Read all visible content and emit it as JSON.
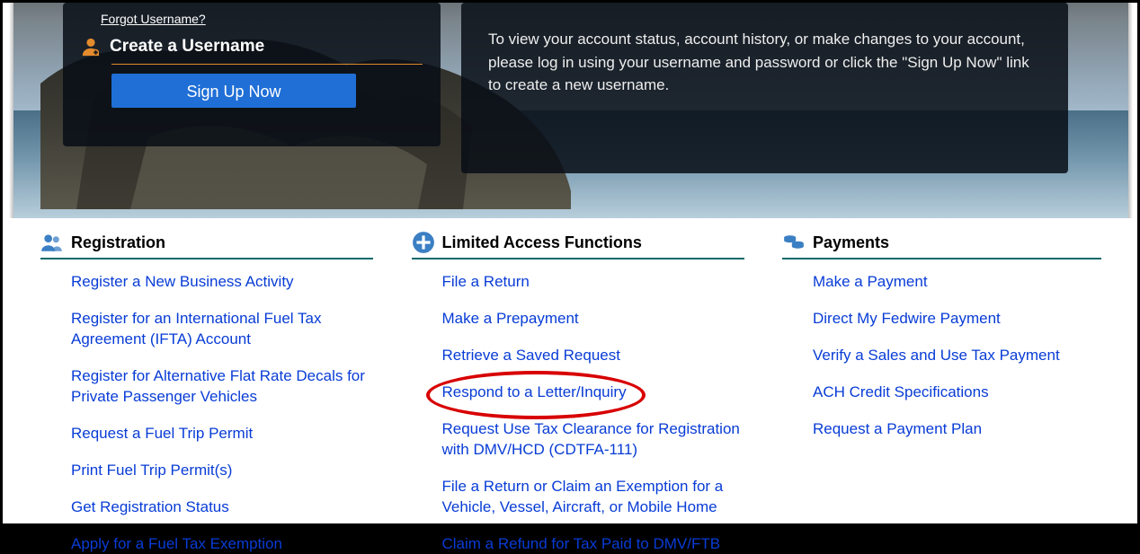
{
  "login_card": {
    "forgot_username": "Forgot Username?",
    "create_username": "Create a Username",
    "signup_button": "Sign Up Now"
  },
  "info_card": {
    "text": "To view your account status, account history, or make changes to your account, please log in using your username and password or click the \"Sign Up Now\" link to create a new username."
  },
  "sections": {
    "registration": {
      "title": "Registration",
      "links": [
        "Register a New Business Activity",
        "Register for an International Fuel Tax Agreement (IFTA) Account",
        "Register for Alternative Flat Rate Decals for Private Passenger Vehicles",
        "Request a Fuel Trip Permit",
        "Print Fuel Trip Permit(s)",
        "Get Registration Status",
        "Apply for a Fuel Tax Exemption"
      ]
    },
    "limited": {
      "title": "Limited Access Functions",
      "links": [
        "File a Return",
        "Make a Prepayment",
        "Retrieve a Saved Request",
        "Respond to a Letter/Inquiry",
        "Request Use Tax Clearance for Registration with DMV/HCD (CDTFA-111)",
        "File a Return or Claim an Exemption for a Vehicle, Vessel, Aircraft, or Mobile Home",
        "Claim a Refund for Tax Paid to DMV/FTB"
      ],
      "highlight_index": 3
    },
    "payments": {
      "title": "Payments",
      "links": [
        "Make a Payment",
        "Direct My Fedwire Payment",
        "Verify a Sales and Use Tax Payment",
        "ACH Credit Specifications",
        "Request a Payment Plan"
      ]
    }
  },
  "colors": {
    "accent_orange": "#e38b2e",
    "link_blue": "#083cd6",
    "btn_blue": "#1f6fd6",
    "section_underline": "#0a6a6a",
    "highlight_red": "#d80000"
  }
}
